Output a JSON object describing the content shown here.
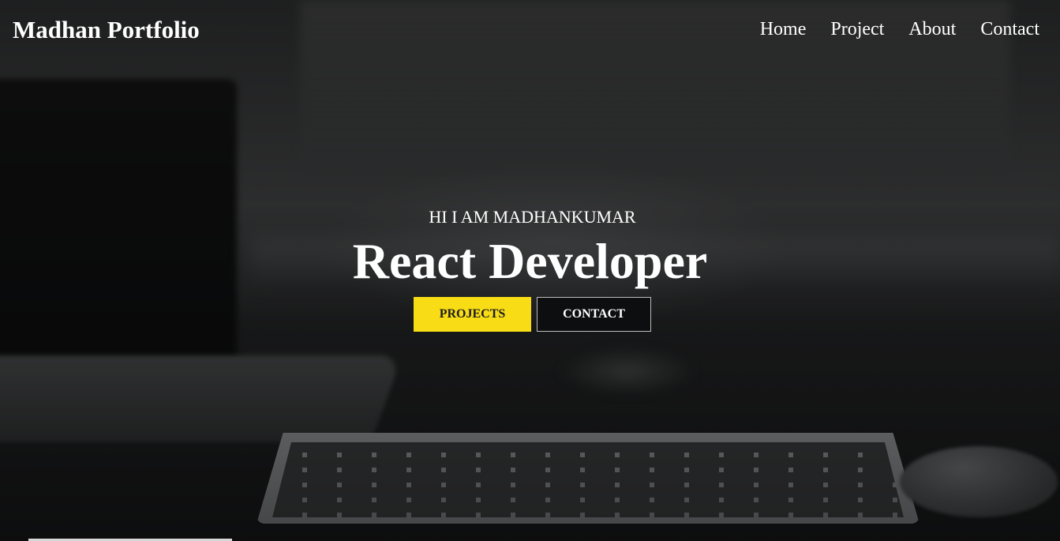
{
  "navbar": {
    "brand": "Madhan Portfolio",
    "links": [
      "Home",
      "Project",
      "About",
      "Contact"
    ]
  },
  "hero": {
    "greeting": "HI I AM MADHANKUMAR",
    "headline": "React Developer",
    "primary_button": "PROJECTS",
    "secondary_button": "CONTACT"
  },
  "colors": {
    "accent": "#f8dc15",
    "text": "#ffffff",
    "secondary_button_bg": "#0d0e0f"
  }
}
